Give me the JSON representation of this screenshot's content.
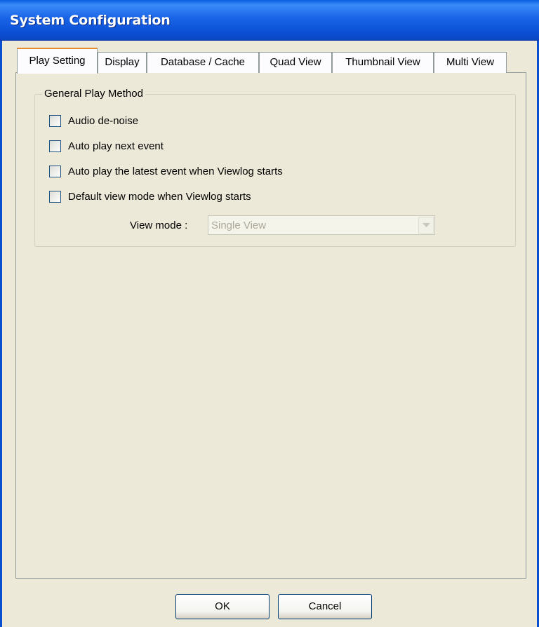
{
  "window": {
    "title": "System Configuration"
  },
  "tabs": [
    {
      "label": "Play Setting",
      "active": true
    },
    {
      "label": "Display",
      "active": false
    },
    {
      "label": "Database / Cache",
      "active": false
    },
    {
      "label": "Quad View",
      "active": false
    },
    {
      "label": "Thumbnail View",
      "active": false
    },
    {
      "label": "Multi View",
      "active": false
    }
  ],
  "group": {
    "title": "General Play Method",
    "options": [
      {
        "label": "Audio de-noise",
        "checked": false
      },
      {
        "label": "Auto play next event",
        "checked": false
      },
      {
        "label": "Auto play the latest event when Viewlog starts",
        "checked": false
      },
      {
        "label": "Default view mode when Viewlog starts",
        "checked": false
      }
    ],
    "view_mode": {
      "label": "View mode :",
      "value": "Single View",
      "disabled": true
    }
  },
  "buttons": {
    "ok": "OK",
    "cancel": "Cancel"
  },
  "colors": {
    "titlebar": "#0b50d4",
    "dialog_bg": "#ece9d8",
    "active_tab_accent": "#e68b2c"
  }
}
